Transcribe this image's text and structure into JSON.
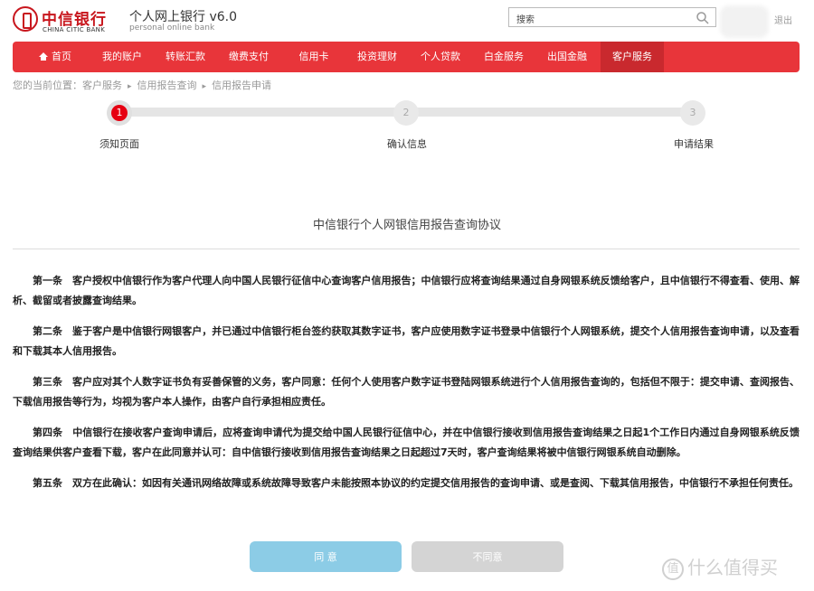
{
  "header": {
    "bank_name_cn": "中信银行",
    "bank_name_en": "CHINA CITIC BANK",
    "site_title": "个人网上银行 v6.0",
    "site_subtitle": "personal online bank",
    "search_placeholder": "搜索",
    "logout_label": "退出"
  },
  "nav": {
    "items": [
      {
        "label": "首页"
      },
      {
        "label": "我的账户"
      },
      {
        "label": "转账汇款"
      },
      {
        "label": "缴费支付"
      },
      {
        "label": "信用卡"
      },
      {
        "label": "投资理财"
      },
      {
        "label": "个人贷款"
      },
      {
        "label": "白金服务"
      },
      {
        "label": "出国金融"
      },
      {
        "label": "客户服务"
      }
    ],
    "active_index": 9
  },
  "breadcrumb": {
    "prefix": "您的当前位置：",
    "items": [
      "客户服务",
      "信用报告查询",
      "信用报告申请"
    ],
    "separator": "▸"
  },
  "steps": {
    "items": [
      {
        "number": "1",
        "label": "须知页面"
      },
      {
        "number": "2",
        "label": "确认信息"
      },
      {
        "number": "3",
        "label": "申请结果"
      }
    ],
    "current": 1
  },
  "document": {
    "title": "中信银行个人网银信用报告查询协议",
    "clauses": [
      "第一条　客户授权中信银行作为客户代理人向中国人民银行征信中心查询客户信用报告；中信银行应将查询结果通过自身网银系统反馈给客户，且中信银行不得查看、使用、解析、截留或者披露查询结果。",
      "第二条　鉴于客户是中信银行网银客户，并已通过中信银行柜台签约获取其数字证书，客户应使用数字证书登录中信银行个人网银系统，提交个人信用报告查询申请，以及查看和下载其本人信用报告。",
      "第三条　客户应对其个人数字证书负有妥善保管的义务，客户同意：任何个人使用客户数字证书登陆网银系统进行个人信用报告查询的，包括但不限于：提交申请、查阅报告、下载信用报告等行为，均视为客户本人操作，由客户自行承担相应责任。",
      "第四条　中信银行在接收客户查询申请后，应将查询申请代为提交给中国人民银行征信中心，并在中信银行接收到信用报告查询结果之日起1个工作日内通过自身网银系统反馈查询结果供客户查看下载，客户在此同意并认可：自中信银行接收到信用报告查询结果之日起超过7天时，客户查询结果将被中信银行网银系统自动删除。",
      "第五条　双方在此确认：如因有关通讯网络故障或系统故障导致客户未能按照本协议的约定提交信用报告的查询申请、或是查阅、下载其信用报告，中信银行不承担任何责任。"
    ]
  },
  "actions": {
    "agree_label": "同 意",
    "disagree_label": "不同意"
  },
  "watermark": {
    "mark": "值",
    "text": "什么值得买"
  },
  "colors": {
    "brand_red": "#e8353a",
    "nav_active": "#c9292e",
    "step_active": "#e60012",
    "agree_button": "#8ccce6",
    "disagree_button": "#d4d4d4"
  }
}
